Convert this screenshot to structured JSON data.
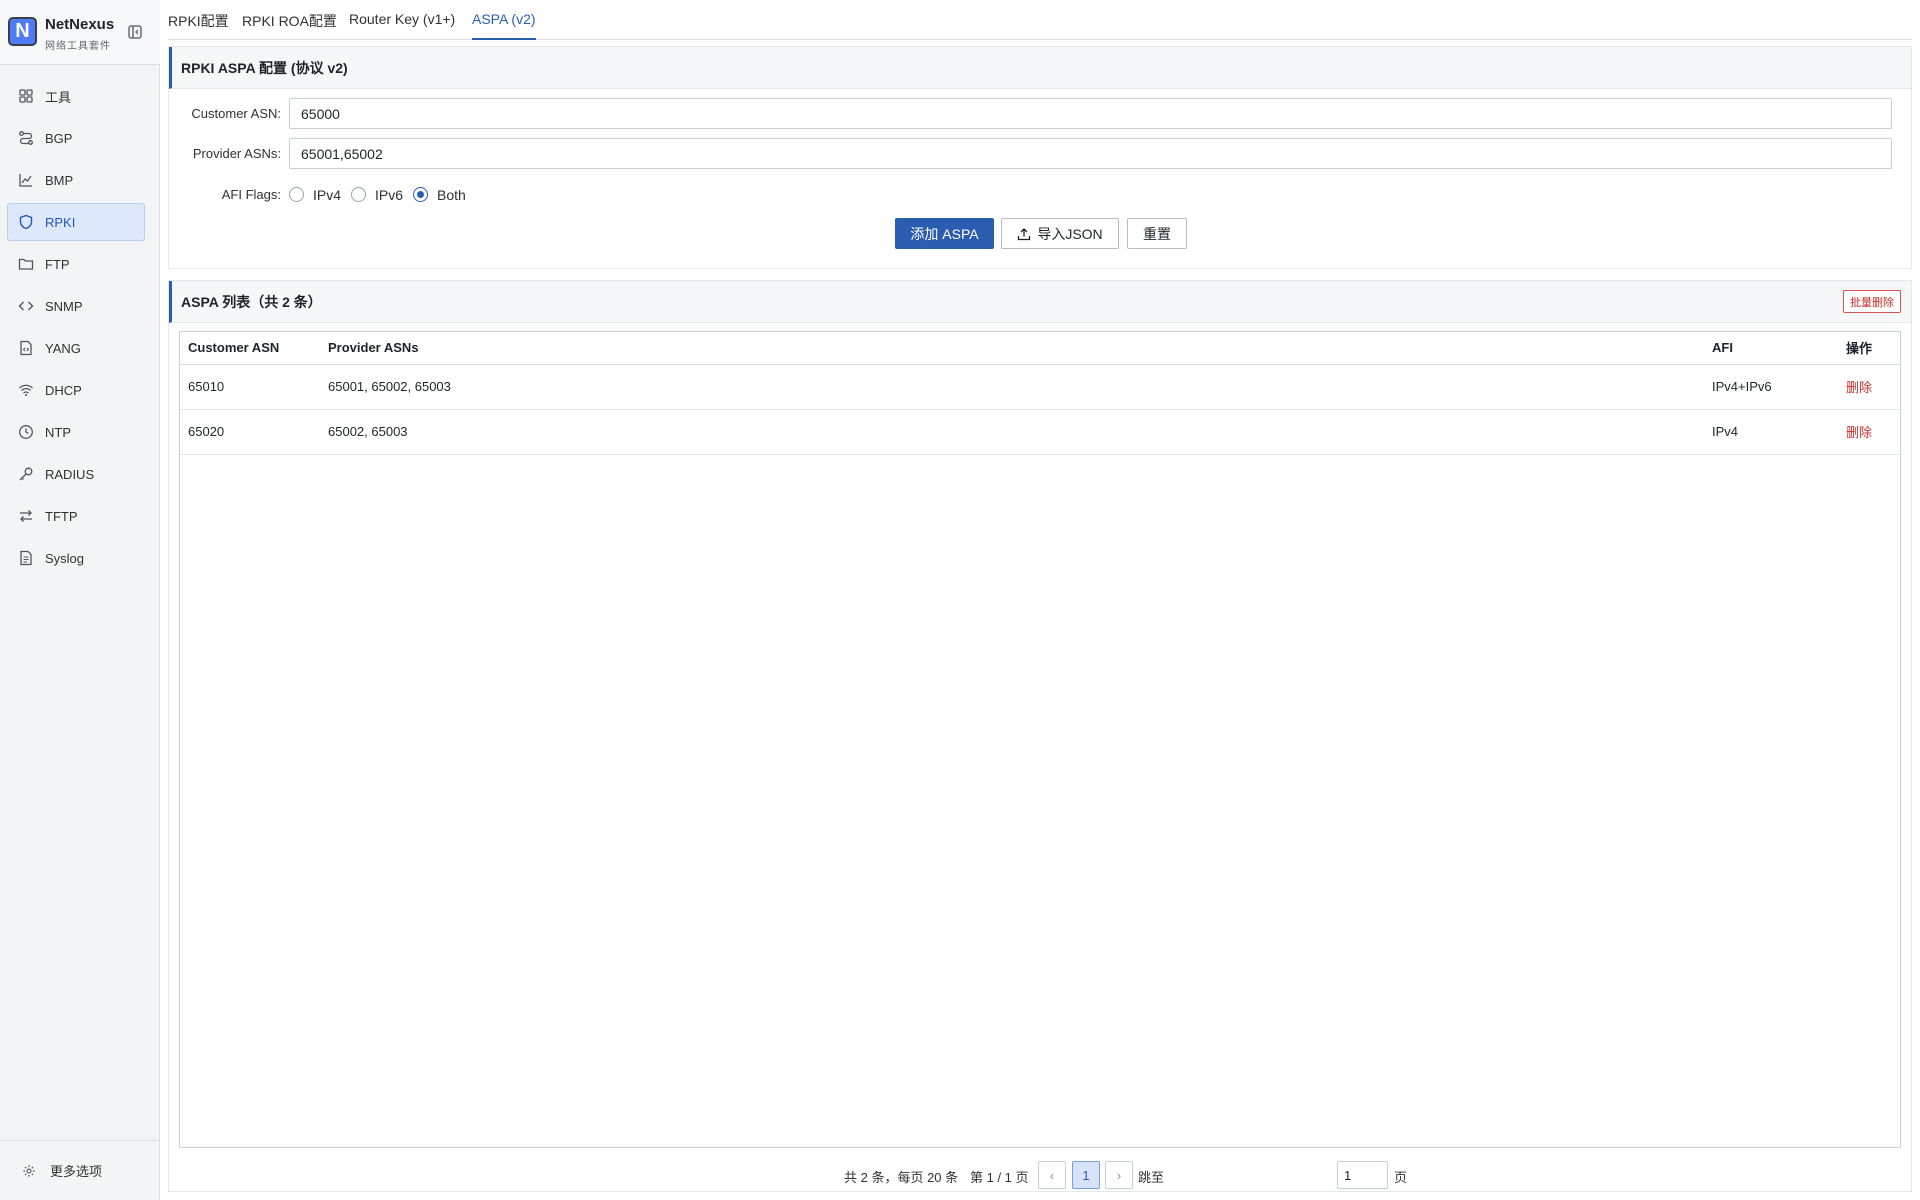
{
  "brand": {
    "name": "NetNexus",
    "subtitle": "网络工具套件",
    "logo_letter": "N"
  },
  "sidebar": {
    "items": [
      {
        "label": "工具",
        "icon": "grid-icon"
      },
      {
        "label": "BGP",
        "icon": "route-icon"
      },
      {
        "label": "BMP",
        "icon": "chart-icon"
      },
      {
        "label": "RPKI",
        "icon": "shield-icon",
        "active": true
      },
      {
        "label": "FTP",
        "icon": "folder-icon"
      },
      {
        "label": "SNMP",
        "icon": "code-icon"
      },
      {
        "label": "YANG",
        "icon": "file-code-icon"
      },
      {
        "label": "DHCP",
        "icon": "wifi-icon"
      },
      {
        "label": "NTP",
        "icon": "clock-icon"
      },
      {
        "label": "RADIUS",
        "icon": "key-icon"
      },
      {
        "label": "TFTP",
        "icon": "transfer-icon"
      },
      {
        "label": "Syslog",
        "icon": "document-icon"
      }
    ],
    "more_label": "更多选项"
  },
  "tabs": [
    {
      "label": "RPKI配置"
    },
    {
      "label": "RPKI ROA配置"
    },
    {
      "label": "Router Key (v1+)"
    },
    {
      "label": "ASPA (v2)",
      "active": true
    }
  ],
  "config": {
    "title": "RPKI ASPA 配置 (协议 v2)",
    "customer_asn_label": "Customer ASN:",
    "customer_asn_value": "65000",
    "provider_asns_label": "Provider ASNs:",
    "provider_asns_value": "65001,65002",
    "afi_label": "AFI Flags:",
    "afi_options": [
      "IPv4",
      "IPv6",
      "Both"
    ],
    "afi_selected": "Both",
    "add_button": "添加 ASPA",
    "import_button": "导入JSON",
    "reset_button": "重置"
  },
  "list": {
    "title": "ASPA 列表（共 2 条）",
    "batch_delete": "批量删除",
    "columns": [
      "Customer ASN",
      "Provider ASNs",
      "AFI",
      "操作"
    ],
    "rows": [
      {
        "customer": "65010",
        "providers": "65001, 65002, 65003",
        "afi": "IPv4+IPv6",
        "action": "删除"
      },
      {
        "customer": "65020",
        "providers": "65002, 65003",
        "afi": "IPv4",
        "action": "删除"
      }
    ]
  },
  "pagination": {
    "summary": "共 2 条，每页 20 条",
    "page_info": "第 1 / 1 页",
    "prev": "‹",
    "current": "1",
    "next": "›",
    "jump_label": "跳至",
    "jump_value": "1",
    "jump_suffix": "页"
  },
  "colors": {
    "accent": "#2a5db0",
    "danger": "#c9302c",
    "sidebar_bg": "#f3f4f6"
  }
}
